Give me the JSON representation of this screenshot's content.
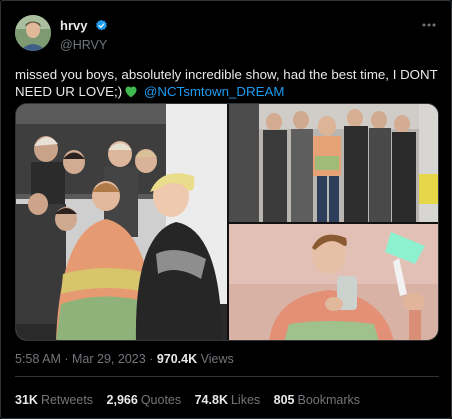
{
  "tweet": {
    "display_name": "hrvy",
    "handle": "@HRVY",
    "verified": true,
    "text_before_heart": "missed you boys, absolutely incredible show, had the best time, I DONT NEED UR LOVE;)",
    "heart_icon": "green-heart-icon",
    "mention": "@NCTsmtown_DREAM",
    "time": "5:58 AM",
    "separator": "·",
    "date": "Mar 29, 2023",
    "views_count": "970.4K",
    "views_label": "Views",
    "media": [
      {
        "name": "group-backstage-photo"
      },
      {
        "name": "group-standing-photo"
      },
      {
        "name": "selfie-lightstick-photo"
      }
    ]
  },
  "stats": [
    {
      "value": "31K",
      "label": "Retweets"
    },
    {
      "value": "2,966",
      "label": "Quotes"
    },
    {
      "value": "74.8K",
      "label": "Likes"
    },
    {
      "value": "805",
      "label": "Bookmarks"
    }
  ],
  "colors": {
    "background": "#000000",
    "text": "#e7e9ea",
    "muted": "#71767b",
    "link": "#1d9bf0",
    "border": "#2f3336",
    "heart": "#3fb950"
  }
}
